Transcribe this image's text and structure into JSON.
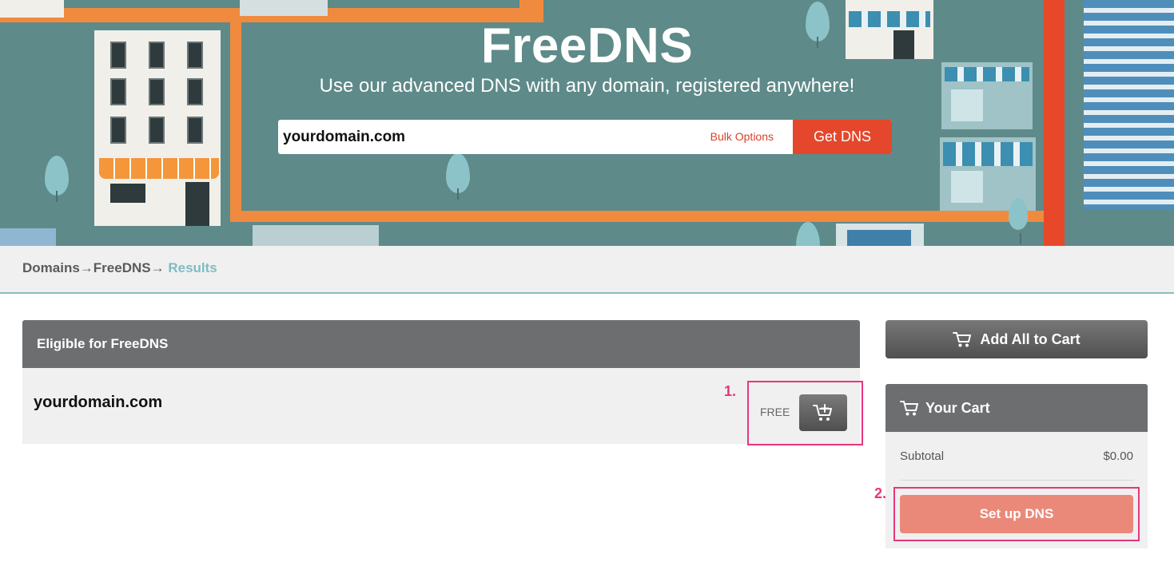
{
  "hero": {
    "title": "FreeDNS",
    "subtitle": "Use our advanced DNS with any domain, registered anywhere!",
    "search_value": "yourdomain.com",
    "bulk_options": "Bulk Options",
    "get_dns": "Get DNS"
  },
  "breadcrumb": {
    "items": [
      "Domains→",
      "FreeDNS→",
      "Results"
    ]
  },
  "results": {
    "header": "Eligible for FreeDNS",
    "rows": [
      {
        "domain": "yourdomain.com",
        "price": "FREE"
      }
    ]
  },
  "sidebar": {
    "add_all": "Add All to Cart",
    "cart_title": "Your Cart",
    "subtotal_label": "Subtotal",
    "subtotal_value": "$0.00",
    "setup_button": "Set up DNS"
  },
  "annotations": [
    "1.",
    "2."
  ],
  "colors": {
    "accent_red": "#e4472b",
    "link_teal": "#7ebdc2",
    "annotation_pink": "#e8357a",
    "setup_salmon": "#ea8979",
    "header_gray": "#6d6e70"
  },
  "icons": [
    "cart-icon",
    "cart-add-icon"
  ]
}
